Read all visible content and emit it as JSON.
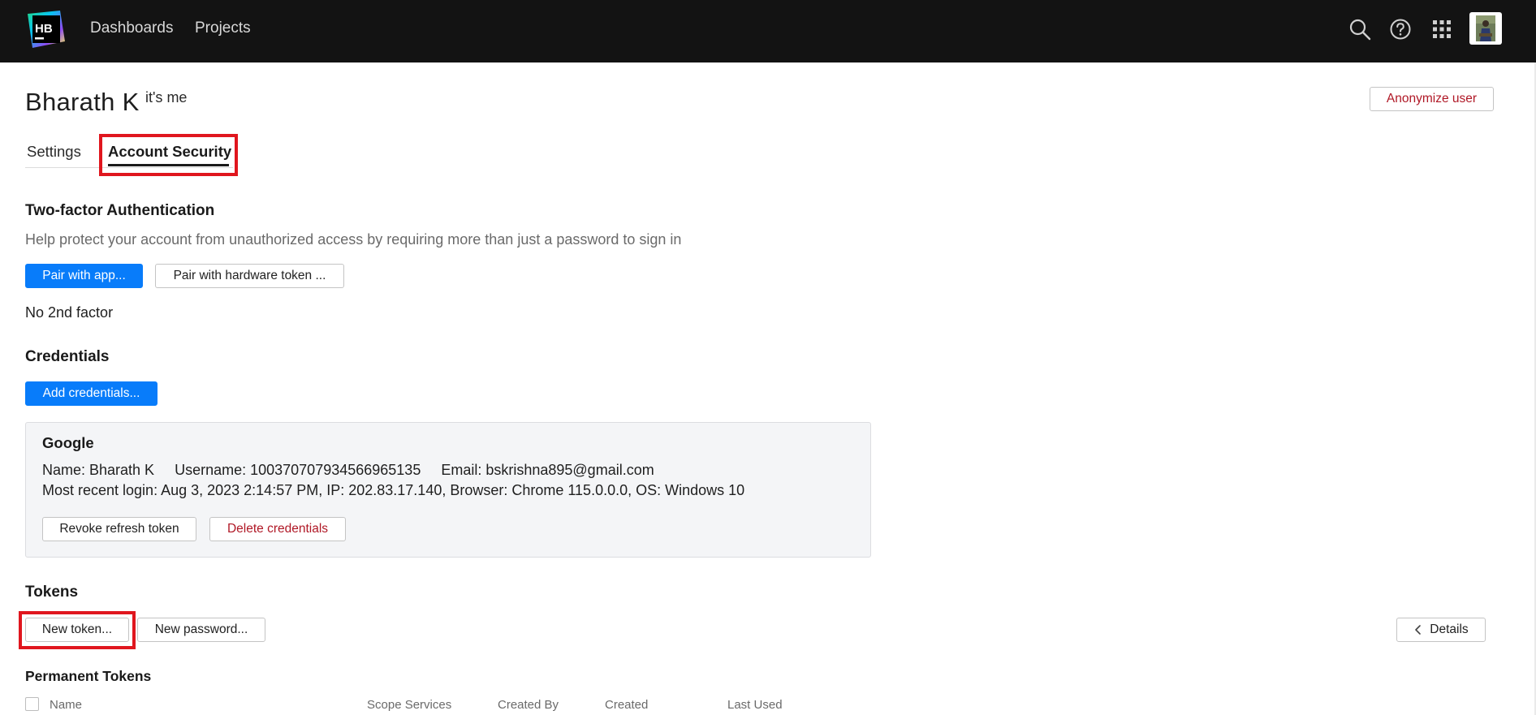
{
  "nav": {
    "logo_text": "HB",
    "links": [
      "Dashboards",
      "Projects"
    ],
    "icons": [
      "search-icon",
      "help-icon",
      "apps-grid-icon"
    ]
  },
  "header": {
    "user_name": "Bharath K",
    "user_note": "it's me",
    "anonymize_label": "Anonymize user"
  },
  "tabs": [
    {
      "label": "Settings",
      "active": false
    },
    {
      "label": "Account Security",
      "active": true
    }
  ],
  "two_factor": {
    "title": "Two-factor Authentication",
    "description": "Help protect your account from unauthorized access by requiring more than just a password to sign in",
    "pair_app_label": "Pair with app...",
    "pair_hardware_label": "Pair with hardware token ...",
    "status": "No 2nd factor"
  },
  "credentials": {
    "title": "Credentials",
    "add_label": "Add credentials...",
    "card": {
      "provider": "Google",
      "details_line": "Name: Bharath K     Username: 100370707934566965135     Email: bskrishna895@gmail.com",
      "login_line": "Most recent login: Aug 3, 2023 2:14:57 PM, IP: 202.83.17.140, Browser: Chrome 115.0.0.0, OS: Windows 10",
      "revoke_label": "Revoke refresh token",
      "delete_label": "Delete credentials"
    }
  },
  "tokens": {
    "title": "Tokens",
    "new_token_label": "New token...",
    "new_password_label": "New password...",
    "details_label": "Details",
    "permanent_title": "Permanent Tokens",
    "columns": [
      "Name",
      "Scope Services",
      "Created By",
      "Created",
      "Last Used"
    ]
  },
  "colors": {
    "topbar": "#131313",
    "primary": "#087cfa",
    "danger": "#b01826",
    "highlight": "#e0161e"
  }
}
